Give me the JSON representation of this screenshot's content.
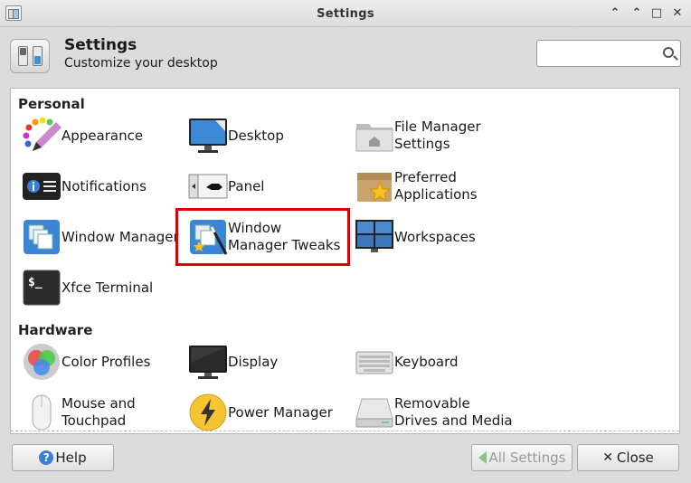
{
  "window": {
    "title": "Settings",
    "controls": {
      "minimize": "⌃",
      "shade": "⌃",
      "maximize": "□",
      "close": "✕"
    }
  },
  "header": {
    "title": "Settings",
    "subtitle": "Customize your desktop",
    "search_placeholder": ""
  },
  "sections": [
    {
      "title": "Personal",
      "items": [
        {
          "label": "Appearance",
          "icon": "appearance-icon"
        },
        {
          "label": "Desktop",
          "icon": "desktop-icon"
        },
        {
          "label": "File Manager\nSettings",
          "icon": "file-manager-icon"
        },
        {
          "label": "Notifications",
          "icon": "notifications-icon"
        },
        {
          "label": "Panel",
          "icon": "panel-icon"
        },
        {
          "label": "Preferred\nApplications",
          "icon": "preferred-applications-icon"
        },
        {
          "label": "Window Manager",
          "icon": "window-manager-icon"
        },
        {
          "label": "Window\nManager Tweaks",
          "icon": "window-manager-tweaks-icon"
        },
        {
          "label": "Workspaces",
          "icon": "workspaces-icon"
        },
        {
          "label": "Xfce Terminal",
          "icon": "terminal-icon"
        }
      ]
    },
    {
      "title": "Hardware",
      "items": [
        {
          "label": "Color Profiles",
          "icon": "color-profiles-icon"
        },
        {
          "label": "Display",
          "icon": "display-icon"
        },
        {
          "label": "Keyboard",
          "icon": "keyboard-icon"
        },
        {
          "label": "Mouse and\nTouchpad",
          "icon": "mouse-icon"
        },
        {
          "label": "Power Manager",
          "icon": "power-manager-icon"
        },
        {
          "label": "Removable\nDrives and Media",
          "icon": "removable-drives-icon"
        }
      ]
    }
  ],
  "footer": {
    "help_label": "Help",
    "all_settings_label": "All Settings",
    "close_label": "Close"
  },
  "colors": {
    "highlight": "#e00000",
    "accent": "#3a7fd5"
  }
}
